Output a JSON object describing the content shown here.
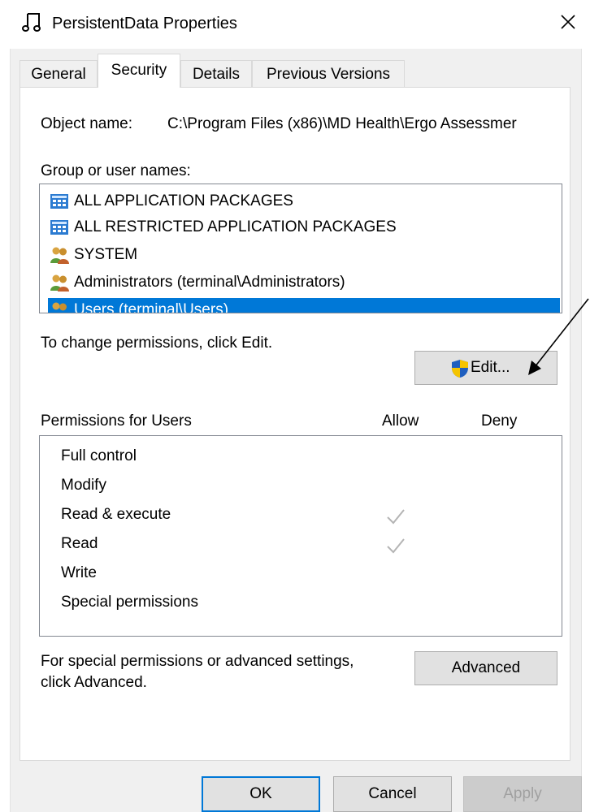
{
  "window": {
    "title": "PersistentData Properties",
    "icon": "music-note-file-icon",
    "close_icon": "close-icon"
  },
  "tabs": [
    {
      "label": "General",
      "active": false
    },
    {
      "label": "Security",
      "active": true
    },
    {
      "label": "Details",
      "active": false
    },
    {
      "label": "Previous Versions",
      "active": false
    }
  ],
  "security": {
    "object_name_label": "Object name:",
    "object_name_value": "C:\\Program Files (x86)\\MD Health\\Ergo Assessmer",
    "group_label": "Group or user names:",
    "principals": [
      {
        "name": "ALL APPLICATION PACKAGES",
        "icon": "app-package-icon",
        "selected": false
      },
      {
        "name": "ALL RESTRICTED APPLICATION PACKAGES",
        "icon": "app-package-icon",
        "selected": false
      },
      {
        "name": "SYSTEM",
        "icon": "user-group-icon",
        "selected": false
      },
      {
        "name": "Administrators (terminal\\Administrators)",
        "icon": "user-group-icon",
        "selected": false
      },
      {
        "name": "Users (terminal\\Users)",
        "icon": "user-group-icon",
        "selected": true
      }
    ],
    "change_hint": "To change permissions, click Edit.",
    "edit_button": "Edit...",
    "edit_icon": "uac-shield-icon",
    "permissions_header": "Permissions for Users",
    "allow_header": "Allow",
    "deny_header": "Deny",
    "permissions": [
      {
        "name": "Full control",
        "allow": false,
        "deny": false
      },
      {
        "name": "Modify",
        "allow": false,
        "deny": false
      },
      {
        "name": "Read & execute",
        "allow": true,
        "deny": false
      },
      {
        "name": "Read",
        "allow": true,
        "deny": false
      },
      {
        "name": "Write",
        "allow": false,
        "deny": false
      },
      {
        "name": "Special permissions",
        "allow": false,
        "deny": false
      }
    ],
    "advanced_hint_line1": "For special permissions or advanced settings,",
    "advanced_hint_line2": "click Advanced.",
    "advanced_button": "Advanced"
  },
  "footer": {
    "ok": "OK",
    "cancel": "Cancel",
    "apply": "Apply"
  },
  "colors": {
    "selection": "#0078d7",
    "check": "#b4b4b4",
    "shield_blue": "#1f5fbf",
    "shield_yellow": "#f5c400"
  }
}
